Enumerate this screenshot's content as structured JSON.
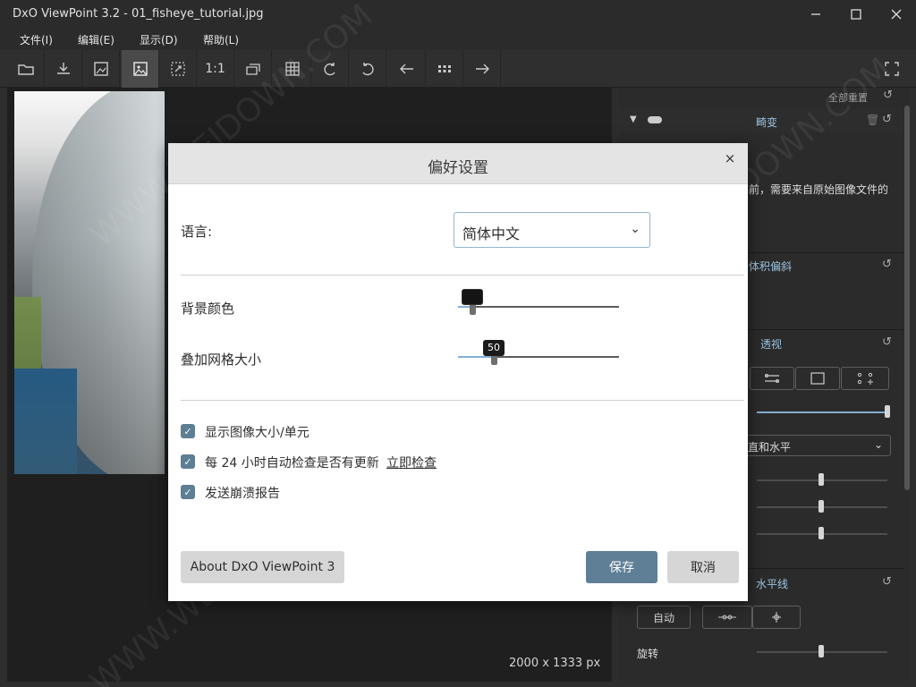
{
  "window": {
    "title": "DxO ViewPoint 3.2 - 01_fisheye_tutorial.jpg"
  },
  "menu": [
    "文件(I)",
    "编辑(E)",
    "显示(D)",
    "帮助(L)"
  ],
  "toolbar": {
    "one_to_one": "1:1"
  },
  "canvas": {
    "image_size": "2000 x 1333 px"
  },
  "panel": {
    "reset_all": "全部重置",
    "distortion_title": "畸变",
    "desc_text": "前，需要来自原始图像文件的",
    "volume_title": "体积偏斜",
    "perspective_title": "透视",
    "perspective_dropdown": "直和水平",
    "horizon_title": "水平线",
    "auto_label": "自动",
    "rotate_label": "旋转"
  },
  "dialog": {
    "title": "偏好设置",
    "close": "×",
    "language_label": "语言:",
    "language_value": "简体中文",
    "bg_color_label": "背景颜色",
    "grid_size_label": "叠加网格大小",
    "grid_size_value": "50",
    "grid_size_fraction": 0.22,
    "bg_color_fraction": 0.09,
    "chk_image_size": "显示图像大小/单元",
    "chk_auto_update": "每 24 小时自动检查是否有更新",
    "check_now": "立即检查",
    "chk_crash_report": "发送崩溃报告",
    "about_button": "About DxO ViewPoint 3",
    "save_button": "保存",
    "cancel_button": "取消"
  },
  "colors": {
    "accent": "#5f7f97",
    "highlight": "#7fb1d3"
  },
  "watermark": "WWW.WEIDOWN.COM"
}
